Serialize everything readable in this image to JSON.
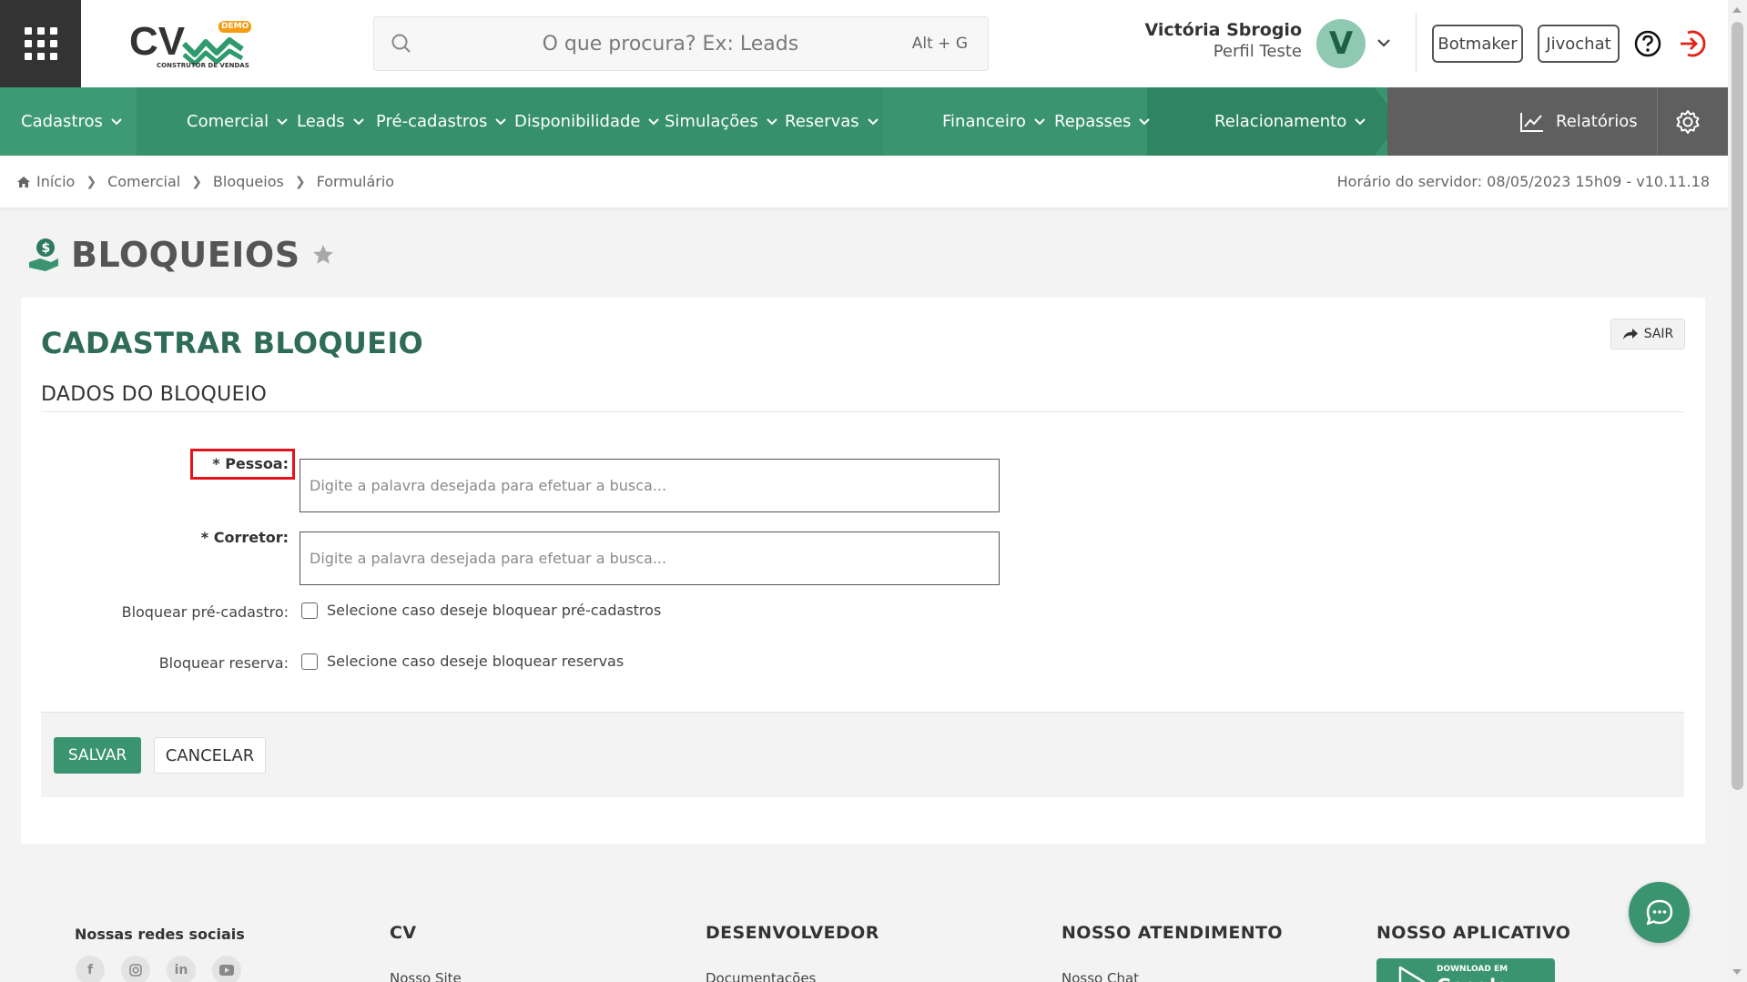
{
  "header": {
    "search_placeholder": "O que procura? Ex: Leads",
    "search_shortcut": "Alt + G",
    "logo_badge": "DEMO",
    "logo_subtitle": "CONSTRUTOR DE VENDAS",
    "user_name": "Victória Sbrogio",
    "user_profile": "Perfil Teste",
    "avatar_letter": "V",
    "btn_botmaker": "Botmaker",
    "btn_jivochat": "Jivochat"
  },
  "nav": {
    "items": [
      {
        "label": "Cadastros"
      },
      {
        "label": "Comercial"
      },
      {
        "label": "Leads"
      },
      {
        "label": "Pré-cadastros"
      },
      {
        "label": "Disponibilidade"
      },
      {
        "label": "Simulações"
      },
      {
        "label": "Reservas"
      },
      {
        "label": "Financeiro"
      },
      {
        "label": "Repasses"
      },
      {
        "label": "Relacionamento"
      }
    ],
    "reports_label": "Relatórios"
  },
  "breadcrumb": {
    "items": [
      "Início",
      "Comercial",
      "Bloqueios",
      "Formulário"
    ],
    "server_time": "Horário do servidor: 08/05/2023 15h09 - v10.11.18"
  },
  "page": {
    "title": "BLOQUEIOS"
  },
  "form": {
    "heading": "CADASTRAR BLOQUEIO",
    "exit_label": "SAIR",
    "section_title": "DADOS DO BLOQUEIO",
    "pessoa_label": "* Pessoa:",
    "pessoa_placeholder": "Digite a palavra desejada para efetuar a busca...",
    "corretor_label": "* Corretor:",
    "corretor_placeholder": "Digite a palavra desejada para efetuar a busca...",
    "bloq_precad_label": "Bloquear pré-cadastro:",
    "bloq_precad_text": "Selecione caso deseje bloquear pré-cadastros",
    "bloq_reserva_label": "Bloquear reserva:",
    "bloq_reserva_text": "Selecione caso deseje bloquear reservas",
    "save_label": "SALVAR",
    "cancel_label": "CANCELAR"
  },
  "footer": {
    "social_title": "Nossas redes sociais",
    "cv_title": "CV",
    "cv_link": "Nosso Site",
    "dev_title": "DESENVOLVEDOR",
    "dev_link": "Documentações",
    "support_title": "NOSSO ATENDIMENTO",
    "support_link": "Nosso Chat",
    "app_title": "NOSSO APLICATIVO",
    "gplay_small": "DOWNLOAD EM",
    "gplay_big": "Google Play"
  },
  "colors": {
    "brand_green": "#3a9470",
    "dark_green": "#2e6b59",
    "highlight_red": "#e5121b"
  }
}
